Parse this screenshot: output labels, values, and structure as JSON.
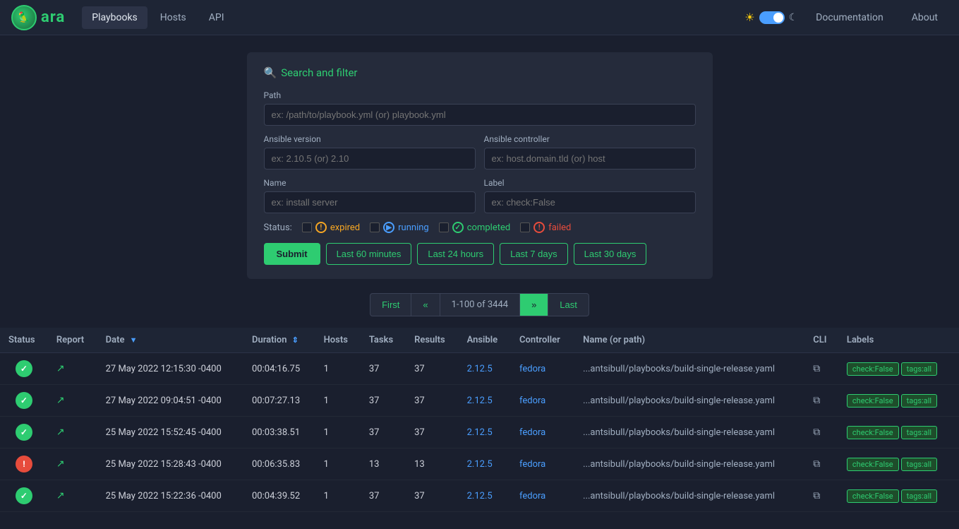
{
  "app": {
    "logo_emoji": "🦜",
    "logo_text": "ara"
  },
  "navbar": {
    "links": [
      {
        "id": "playbooks",
        "label": "Playbooks",
        "active": true
      },
      {
        "id": "hosts",
        "label": "Hosts",
        "active": false
      },
      {
        "id": "api",
        "label": "API",
        "active": false
      }
    ],
    "documentation_label": "Documentation",
    "about_label": "About"
  },
  "search": {
    "title": "Search and filter",
    "path_label": "Path",
    "path_placeholder": "ex: /path/to/playbook.yml (or) playbook.yml",
    "ansible_version_label": "Ansible version",
    "ansible_version_placeholder": "ex: 2.10.5 (or) 2.10",
    "ansible_controller_label": "Ansible controller",
    "ansible_controller_placeholder": "ex: host.domain.tld (or) host",
    "name_label": "Name",
    "name_placeholder": "ex: install server",
    "label_label": "Label",
    "label_placeholder": "ex: check:False",
    "status_label": "Status:",
    "statuses": [
      {
        "id": "expired",
        "label": "expired",
        "icon_type": "expired"
      },
      {
        "id": "running",
        "label": "running",
        "icon_type": "running"
      },
      {
        "id": "completed",
        "label": "completed",
        "icon_type": "completed"
      },
      {
        "id": "failed",
        "label": "failed",
        "icon_type": "failed"
      }
    ],
    "submit_label": "Submit",
    "filter_buttons": [
      {
        "id": "last60",
        "label": "Last 60 minutes"
      },
      {
        "id": "last24",
        "label": "Last 24 hours"
      },
      {
        "id": "last7",
        "label": "Last 7 days"
      },
      {
        "id": "last30",
        "label": "Last 30 days"
      }
    ]
  },
  "pagination": {
    "first_label": "First",
    "prev_label": "«",
    "info": "1-100 of 3444",
    "next_label": "»",
    "last_label": "Last"
  },
  "table": {
    "columns": [
      {
        "id": "status",
        "label": "Status"
      },
      {
        "id": "report",
        "label": "Report"
      },
      {
        "id": "date",
        "label": "Date",
        "sortable": true
      },
      {
        "id": "duration",
        "label": "Duration",
        "sortable": true
      },
      {
        "id": "hosts",
        "label": "Hosts"
      },
      {
        "id": "tasks",
        "label": "Tasks"
      },
      {
        "id": "results",
        "label": "Results"
      },
      {
        "id": "ansible",
        "label": "Ansible"
      },
      {
        "id": "controller",
        "label": "Controller"
      },
      {
        "id": "name_path",
        "label": "Name (or path)"
      },
      {
        "id": "cli",
        "label": "CLI"
      },
      {
        "id": "labels",
        "label": "Labels"
      }
    ],
    "rows": [
      {
        "status": "completed",
        "date": "27 May 2022 12:15:30 -0400",
        "duration": "00:04:16.75",
        "hosts": "1",
        "tasks": "37",
        "results": "37",
        "ansible": "2.12.5",
        "controller": "fedora",
        "path": "...antsibull/playbooks/build-single-release.yaml",
        "tags": [
          "check:False",
          "tags:all"
        ]
      },
      {
        "status": "completed",
        "date": "27 May 2022 09:04:51 -0400",
        "duration": "00:07:27.13",
        "hosts": "1",
        "tasks": "37",
        "results": "37",
        "ansible": "2.12.5",
        "controller": "fedora",
        "path": "...antsibull/playbooks/build-single-release.yaml",
        "tags": [
          "check:False",
          "tags:all"
        ]
      },
      {
        "status": "completed",
        "date": "25 May 2022 15:52:45 -0400",
        "duration": "00:03:38.51",
        "hosts": "1",
        "tasks": "37",
        "results": "37",
        "ansible": "2.12.5",
        "controller": "fedora",
        "path": "...antsibull/playbooks/build-single-release.yaml",
        "tags": [
          "check:False",
          "tags:all"
        ]
      },
      {
        "status": "failed",
        "date": "25 May 2022 15:28:43 -0400",
        "duration": "00:06:35.83",
        "hosts": "1",
        "tasks": "13",
        "results": "13",
        "ansible": "2.12.5",
        "controller": "fedora",
        "path": "...antsibull/playbooks/build-single-release.yaml",
        "tags": [
          "check:False",
          "tags:all"
        ]
      },
      {
        "status": "completed",
        "date": "25 May 2022 15:22:36 -0400",
        "duration": "00:04:39.52",
        "hosts": "1",
        "tasks": "37",
        "results": "37",
        "ansible": "2.12.5",
        "controller": "fedora",
        "path": "...antsibull/playbooks/build-single-release.yaml",
        "tags": [
          "check:False",
          "tags:all"
        ]
      }
    ]
  }
}
